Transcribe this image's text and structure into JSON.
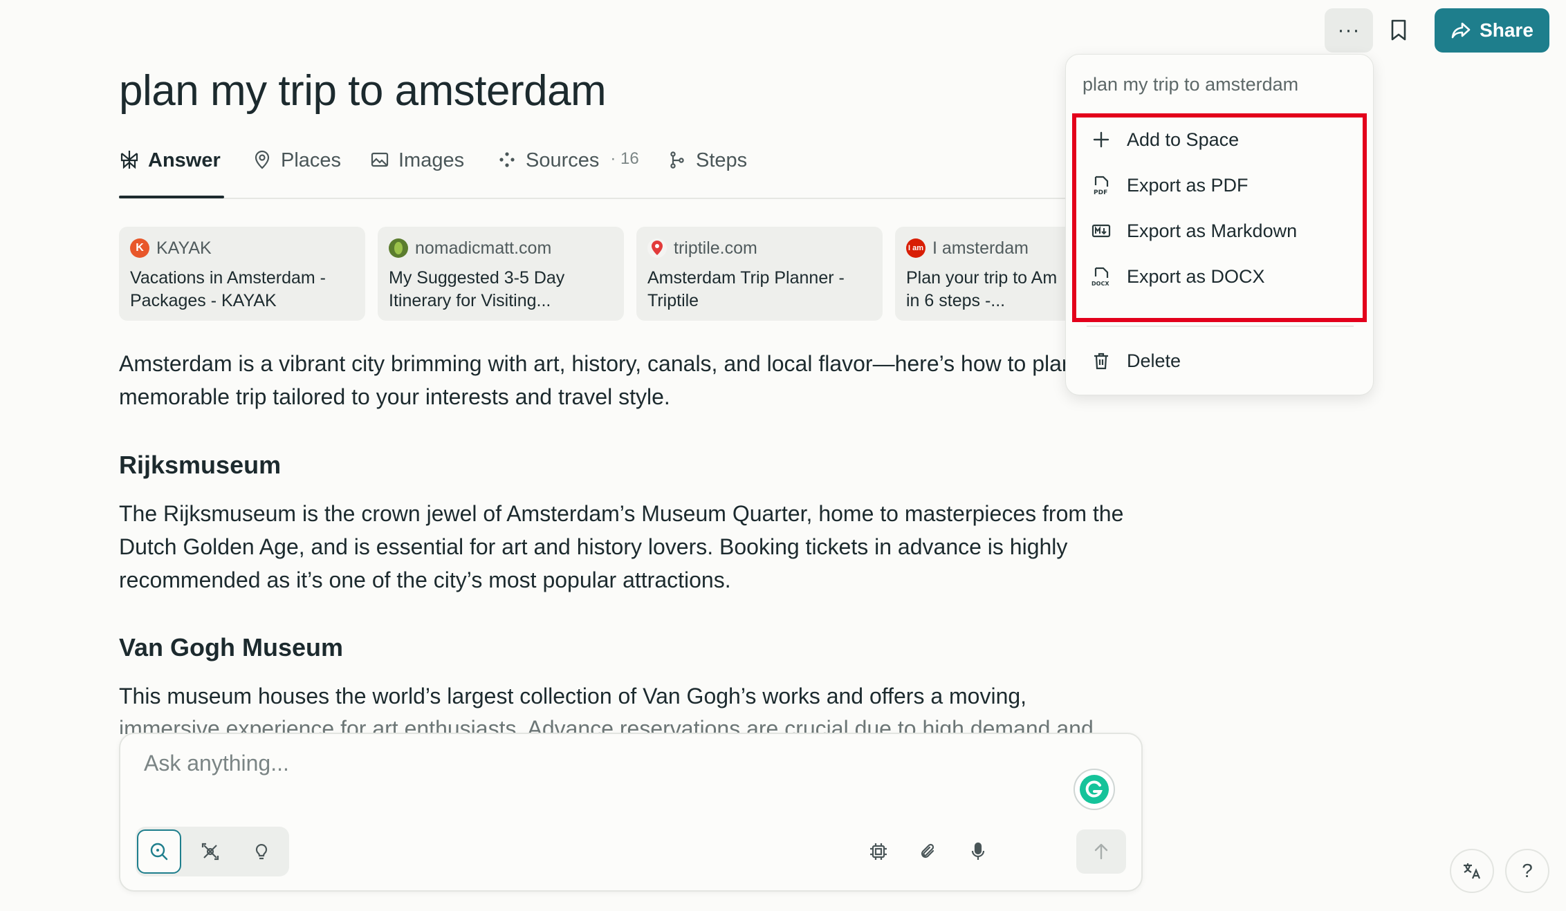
{
  "header": {
    "more_label": "···",
    "share_label": "Share"
  },
  "page_title": "plan my trip to amsterdam",
  "tabs": [
    {
      "label": "Answer"
    },
    {
      "label": "Places"
    },
    {
      "label": "Images"
    },
    {
      "label": "Sources",
      "count": "· 16"
    },
    {
      "label": "Steps"
    }
  ],
  "sources": [
    {
      "site": "KAYAK",
      "favicon_letter": "K",
      "favicon_color": "#e8572a",
      "title_line1": "Vacations in Amsterdam -",
      "title_line2": "Packages - KAYAK"
    },
    {
      "site": "nomadicmatt.com",
      "favicon_letter": "",
      "favicon_color": "#5b7d2e",
      "title_line1": "My Suggested 3-5 Day",
      "title_line2": "Itinerary for Visiting..."
    },
    {
      "site": "triptile.com",
      "favicon_letter": "",
      "favicon_color": "#e23b3b",
      "title_line1": "Amsterdam Trip Planner -",
      "title_line2": "Triptile"
    },
    {
      "site": "I amsterdam",
      "favicon_letter": "I am",
      "favicon_color": "#d81e05",
      "title_line1": "Plan your trip to Am",
      "title_line2": "in 6 steps -..."
    }
  ],
  "intro": "Amsterdam is a vibrant city brimming with art, history, canals, and local flavor—here’s how to plan a memorable trip tailored to your interests and travel style.",
  "sections": [
    {
      "heading": "Rijksmuseum",
      "text": "The Rijksmuseum is the crown jewel of Amsterdam’s Museum Quarter, home to masterpieces from the Dutch Golden Age, and is essential for art and history lovers. Booking tickets in advance is highly recommended as it’s one of the city’s most popular attractions."
    },
    {
      "heading": "Van Gogh Museum",
      "text": "This museum houses the world’s largest collection of Van Gogh’s works and offers a moving,",
      "faded": "immersive experience for art enthusiasts. Advance reservations are crucial due to high demand and"
    }
  ],
  "composer": {
    "placeholder": "Ask anything..."
  },
  "menu": {
    "title": "plan my trip to amsterdam",
    "items": [
      {
        "label": "Add to Space",
        "icon": "plus-icon"
      },
      {
        "label": "Export as PDF",
        "icon": "pdf-file-icon"
      },
      {
        "label": "Export as Markdown",
        "icon": "markdown-icon"
      },
      {
        "label": "Export as DOCX",
        "icon": "docx-file-icon"
      }
    ],
    "delete_label": "Delete"
  },
  "help_label": "?",
  "colors": {
    "accent": "#1e7e8c",
    "highlight": "#e3001b",
    "background": "#fbfbf9"
  }
}
